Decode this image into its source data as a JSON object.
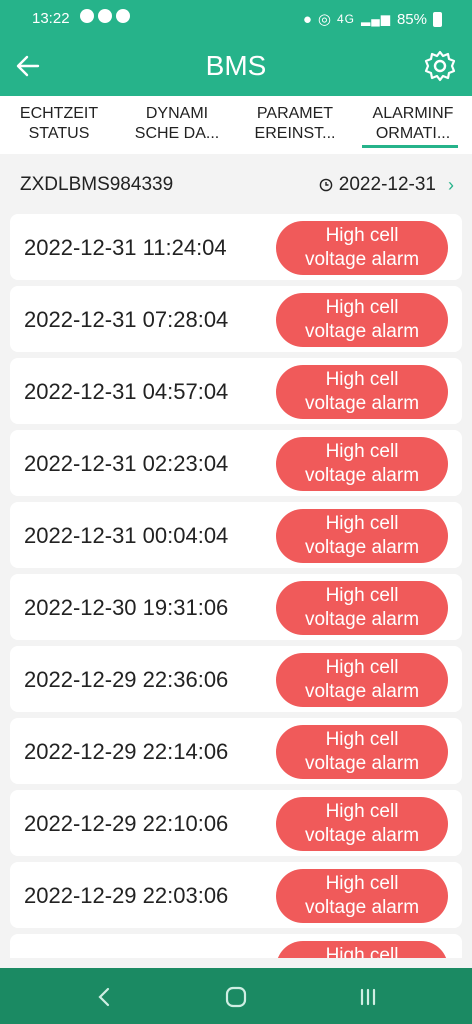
{
  "status_bar": {
    "time": "13:22",
    "battery": "85%",
    "network": "4G"
  },
  "app_bar": {
    "title": "BMS"
  },
  "tabs": [
    {
      "label": "ECHTZEIT\nSTATUS",
      "active": false
    },
    {
      "label": "DYNAMI\nSCHE DA...",
      "active": false
    },
    {
      "label": "PARAMET\nEREINST...",
      "active": false
    },
    {
      "label": "ALARMINF\nORMATI...",
      "active": true
    }
  ],
  "device": {
    "id": "ZXDLBMS984339",
    "date": "2022-12-31"
  },
  "alarms": [
    {
      "timestamp": "2022-12-31 11:24:04",
      "type": "High cell\nvoltage alarm"
    },
    {
      "timestamp": "2022-12-31 07:28:04",
      "type": "High cell\nvoltage alarm"
    },
    {
      "timestamp": "2022-12-31 04:57:04",
      "type": "High cell\nvoltage alarm"
    },
    {
      "timestamp": "2022-12-31 02:23:04",
      "type": "High cell\nvoltage alarm"
    },
    {
      "timestamp": "2022-12-31 00:04:04",
      "type": "High cell\nvoltage alarm"
    },
    {
      "timestamp": "2022-12-30 19:31:06",
      "type": "High cell\nvoltage alarm"
    },
    {
      "timestamp": "2022-12-29 22:36:06",
      "type": "High cell\nvoltage alarm"
    },
    {
      "timestamp": "2022-12-29 22:14:06",
      "type": "High cell\nvoltage alarm"
    },
    {
      "timestamp": "2022-12-29 22:10:06",
      "type": "High cell\nvoltage alarm"
    },
    {
      "timestamp": "2022-12-29 22:03:06",
      "type": "High cell\nvoltage alarm"
    },
    {
      "timestamp": "",
      "type": "High cell\nvoltage alarm"
    }
  ],
  "colors": {
    "primary": "#26b38a",
    "alarm": "#f05a5a",
    "navbar": "#1b8a63"
  }
}
